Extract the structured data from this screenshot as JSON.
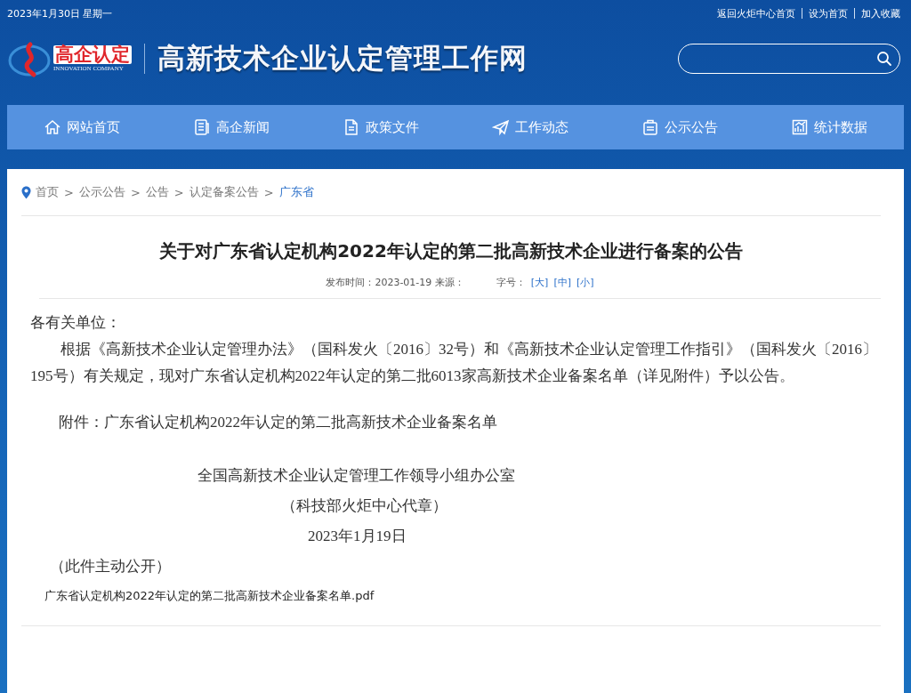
{
  "top_bar": {
    "date": "2023年1月30日 星期一",
    "links": [
      "返回火炬中心首页",
      "设为首页",
      "加入收藏"
    ]
  },
  "header": {
    "logo_text": "高企认定",
    "logo_subtext": "INNOVATION COMPANY",
    "site_title": "高新技术企业认定管理工作网"
  },
  "nav": [
    {
      "label": "网站首页"
    },
    {
      "label": "高企新闻"
    },
    {
      "label": "政策文件"
    },
    {
      "label": "工作动态"
    },
    {
      "label": "公示公告"
    },
    {
      "label": "统计数据"
    }
  ],
  "breadcrumb": {
    "separator": ">",
    "items": [
      {
        "label": "首页",
        "selected": false
      },
      {
        "label": "公示公告",
        "selected": false
      },
      {
        "label": "公告",
        "selected": false
      },
      {
        "label": "认定备案公告",
        "selected": false
      },
      {
        "label": "广东省",
        "selected": true
      }
    ]
  },
  "article": {
    "title": "关于对广东省认定机构2022年认定的第二批高新技术企业进行备案的公告",
    "meta": {
      "published": "发布时间：2023-01-19 来源：",
      "font_label": "字号：",
      "font_sizes": [
        "[大]",
        "[中]",
        "[小]"
      ]
    },
    "body": [
      {
        "kind": "plain",
        "text": "各有关单位："
      },
      {
        "kind": "indent",
        "text": "根据《高新技术企业认定管理办法》（国科发火〔2016〕32号）和《高新技术企业认定管理工作指引》（国科发火〔2016〕195号）有关规定，现对广东省认定机构2022年认定的第二批6013家高新技术企业备案名单（详见附件）予以公告。"
      },
      {
        "kind": "attachment",
        "text": "附件：广东省认定机构2022年认定的第二批高新技术企业备案名单"
      },
      {
        "kind": "signature",
        "text": "全国高新技术企业认定管理工作领导小组办公室"
      },
      {
        "kind": "signature2",
        "text": "（科技部火炬中心代章）"
      },
      {
        "kind": "date",
        "text": "2023年1月19日"
      },
      {
        "kind": "note",
        "text": "（此件主动公开）"
      }
    ],
    "attachment_link": "广东省认定机构2022年认定的第二批高新技术企业备案名单.pdf"
  }
}
